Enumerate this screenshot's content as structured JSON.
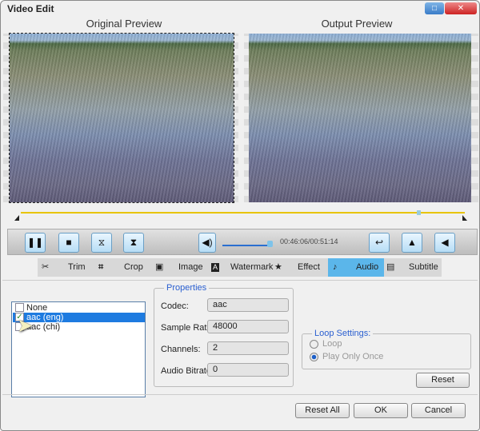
{
  "window": {
    "title": "Video Edit",
    "maximize_icon": "maximize-icon",
    "close_icon": "close-icon"
  },
  "preview": {
    "original_label": "Original Preview",
    "output_label": "Output Preview"
  },
  "player": {
    "time": "00:46:06/00:51:14",
    "timeline_progress": 0.9,
    "volume_level": 0.6
  },
  "tabs": [
    {
      "label": "Trim",
      "icon": "scissors-icon"
    },
    {
      "label": "Crop",
      "icon": "crop-icon"
    },
    {
      "label": "Image",
      "icon": "image-icon"
    },
    {
      "label": "Watermark",
      "icon": "watermark-icon"
    },
    {
      "label": "Effect",
      "icon": "star-icon"
    },
    {
      "label": "Audio",
      "icon": "music-note-icon",
      "active": true
    },
    {
      "label": "Subtitle",
      "icon": "subtitle-icon"
    }
  ],
  "audio": {
    "tracks": [
      {
        "label": "None",
        "checked": false
      },
      {
        "label": "aac (eng)",
        "checked": true,
        "selected": true
      },
      {
        "label": "aac (chi)",
        "checked": false
      }
    ],
    "properties": {
      "title": "Properties",
      "codec_label": "Codec:",
      "codec": "aac",
      "sample_rate_label": "Sample Rate:",
      "sample_rate": "48000",
      "channels_label": "Channels:",
      "channels": "2",
      "bitrate_label": "Audio Bitrate:",
      "bitrate": "0"
    },
    "loop": {
      "title": "Loop Settings:",
      "loop_label": "Loop",
      "once_label": "Play Only Once",
      "selected": "Play Only Once"
    },
    "reset_label": "Reset"
  },
  "footer": {
    "reset_all": "Reset All",
    "ok": "OK",
    "cancel": "Cancel"
  },
  "colors": {
    "accent": "#5bb6ea",
    "selection": "#1e7be0",
    "timeline": "#e8c400"
  }
}
